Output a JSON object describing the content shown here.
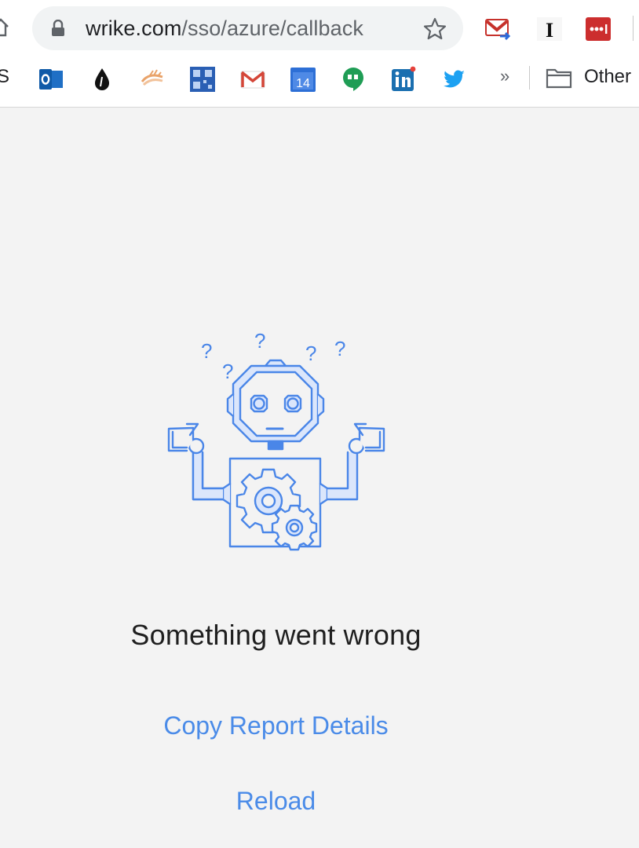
{
  "browser": {
    "url_host": "wrike.com",
    "url_path": "/sso/azure/callback",
    "bookmarks_left_label": "S",
    "bookmarks_overflow": "»",
    "other_bookmarks_label": "Other",
    "calendar_day": "14",
    "extension_icons": [
      "gmail-notifier-icon",
      "instapaper-icon",
      "lastpass-icon"
    ],
    "bookmark_icons": [
      "outlook-icon",
      "ink-drop-icon",
      "hands-icon",
      "qr-icon",
      "gmail-icon",
      "calendar-icon",
      "hangouts-icon",
      "linkedin-icon",
      "twitter-icon"
    ]
  },
  "error": {
    "title": "Something went wrong",
    "copy_report_label": "Copy Report Details",
    "reload_label": "Reload"
  },
  "colors": {
    "accent": "#4a8be8",
    "robot_stroke": "#4a86e8",
    "robot_fill": "#dbe6fb",
    "background": "#f3f3f3"
  }
}
